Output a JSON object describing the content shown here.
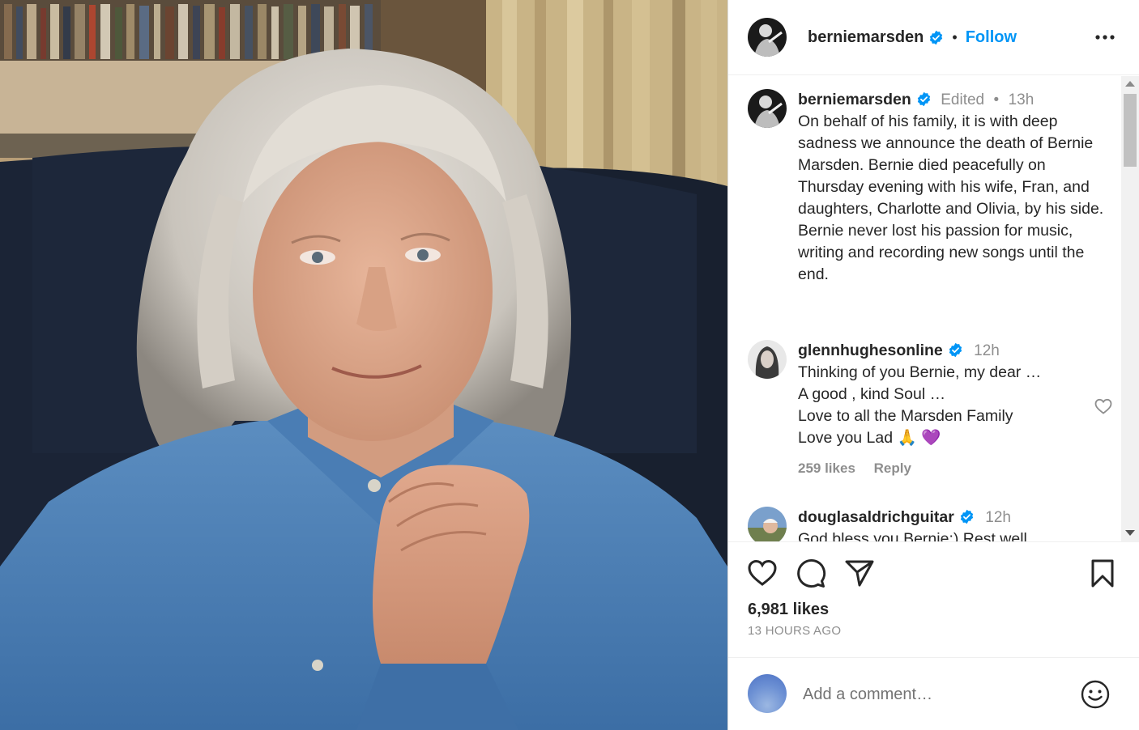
{
  "post": {
    "author": {
      "username": "berniemarsden",
      "follow_label": "Follow",
      "separator": "•"
    },
    "caption": {
      "username": "berniemarsden",
      "edited_label": "Edited",
      "separator": "•",
      "time": "13h",
      "text": "On behalf of his family, it is with deep sadness we announce the death of Bernie Marsden. Bernie died peacefully on Thursday evening with his wife, Fran, and daughters, Charlotte and Olivia, by his side. Bernie never lost his passion for music, writing and recording new songs until the end."
    },
    "comments": [
      {
        "username": "glennhughesonline",
        "time": "12h",
        "lines": "Thinking of you Bernie, my dear …\nA good , kind Soul …\nLove to all the Marsden Family\nLove you Lad 🙏 💜",
        "likes": "259 likes",
        "reply_label": "Reply"
      },
      {
        "username": "douglasaldrichguitar",
        "time": "12h",
        "lines": "God bless you Bernie:) Rest well"
      }
    ],
    "likes_count": "6,981 likes",
    "time_ago": "13 HOURS AGO",
    "comment_placeholder": "Add a comment…",
    "icons": {
      "like": "heart-icon",
      "comment": "speech-bubble-icon",
      "share": "paper-plane-icon",
      "save": "bookmark-icon",
      "more": "more-options-icon",
      "emoji": "smiley-icon",
      "verified": "verified-badge-icon"
    },
    "colors": {
      "accent": "#0095f6",
      "verified": "#0095f6",
      "text": "#262626",
      "muted": "#8e8e8e"
    }
  }
}
